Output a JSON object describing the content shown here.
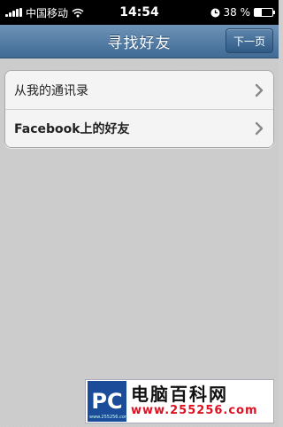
{
  "status_bar": {
    "carrier": "中国移动",
    "time": "14:54",
    "battery_percent": "38 %",
    "battery_level": 0.38,
    "icons": [
      "signal-icon",
      "wifi-icon",
      "clock-icon",
      "battery-icon"
    ]
  },
  "nav": {
    "title": "寻找好友",
    "next_button_label": "下一页"
  },
  "list": {
    "items": [
      {
        "label": "从我的通讯录",
        "icon": "chevron-right-icon"
      },
      {
        "label": "Facebook上的好友",
        "icon": "chevron-right-icon"
      }
    ]
  },
  "watermark": {
    "logo_text": "PC",
    "logo_subtext": "www.255256.com",
    "title": "电脑百科网",
    "url": "www.255256.com"
  },
  "colors": {
    "nav_bar": "#4f7aa3",
    "background": "#cbcbcb"
  }
}
